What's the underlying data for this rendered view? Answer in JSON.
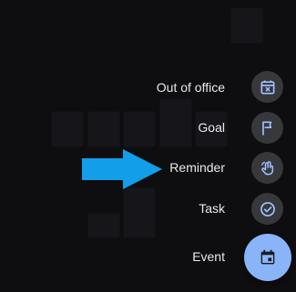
{
  "colors": {
    "accent": "#8ab4f8",
    "fab_icon": "#1a1c20",
    "mini_fab_bg": "#37383c",
    "mini_fab_icon": "#9fc2ff",
    "label": "#e8eaed",
    "arrow": "#129ee8"
  },
  "speed_dial": {
    "items": [
      {
        "label": "Out of office",
        "icon": "calendar-x-icon"
      },
      {
        "label": "Goal",
        "icon": "flag-icon"
      },
      {
        "label": "Reminder",
        "icon": "reminder-hand-icon"
      },
      {
        "label": "Task",
        "icon": "check-circle-icon"
      }
    ],
    "main": {
      "label": "Event",
      "icon": "calendar-event-icon"
    }
  },
  "annotation": {
    "arrow_target": "Reminder",
    "icon": "right-arrow"
  }
}
